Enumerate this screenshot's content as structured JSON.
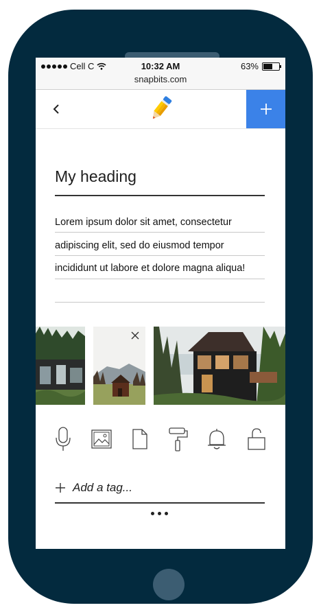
{
  "status_bar": {
    "carrier": "Cell C",
    "time": "10:32 AM",
    "battery": "63%",
    "battery_level": 0.63,
    "url": "snapbits.com"
  },
  "nav": {
    "back_icon": "chevron-left-icon",
    "logo_icon": "pencil-logo-icon",
    "add_icon": "plus-icon",
    "accent": "#3b82e8"
  },
  "note": {
    "heading": "My heading",
    "body_lines": [
      "Lorem ipsum dolor sit amet, consectetur",
      "adipiscing elit, sed do eiusmod tempor",
      "incididunt ut labore et dolore magna aliqua!"
    ]
  },
  "images": [
    {
      "name": "modern-cabin-photo"
    },
    {
      "name": "small-cabin-mountain-photo"
    },
    {
      "name": "waterfront-house-photo"
    }
  ],
  "toolbar": [
    "microphone-icon",
    "image-icon",
    "document-icon",
    "paint-roller-icon",
    "bell-icon",
    "unlock-icon"
  ],
  "tag": {
    "placeholder": "Add a tag..."
  },
  "colors": {
    "phone_body": "#032a3e",
    "phone_detail": "#3c5d72"
  }
}
